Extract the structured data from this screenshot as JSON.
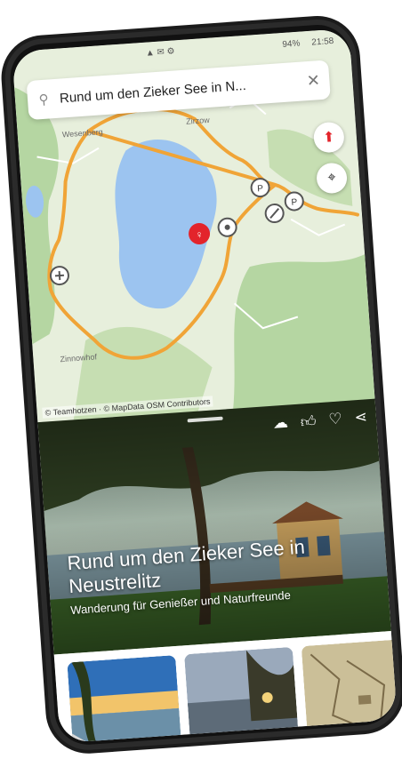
{
  "status": {
    "time": "21:58",
    "battery": "94%",
    "signal": "▲ ✉ ⚙"
  },
  "search": {
    "query": "Rund um den Zieker See in N...",
    "icon": "search-icon",
    "clear_icon": "close-icon"
  },
  "map": {
    "labels": {
      "top_left": "Wesenberg",
      "top_mid": "Zirzow",
      "bottom_left": "Zinnowhof"
    },
    "credit": "© Teamhotzen · © MapData OSM Contributors",
    "colors": {
      "route": "#f0a437",
      "lake": "#9cc4f0",
      "land": "#e7efdc",
      "forest": "#b5d6a2",
      "start_marker": "#e3242b"
    }
  },
  "tour": {
    "title": "Rund um den Zieker See in Neustrelitz",
    "subtitle": "Wanderung für Genießer und Naturfreunde",
    "actions": [
      "download-icon",
      "thumbs-up-icon",
      "heart-icon",
      "share-icon"
    ]
  },
  "gallery": {
    "thumbnails": [
      "lake-pier-photo",
      "lake-evening-photo",
      "map-snippet-photo"
    ]
  }
}
